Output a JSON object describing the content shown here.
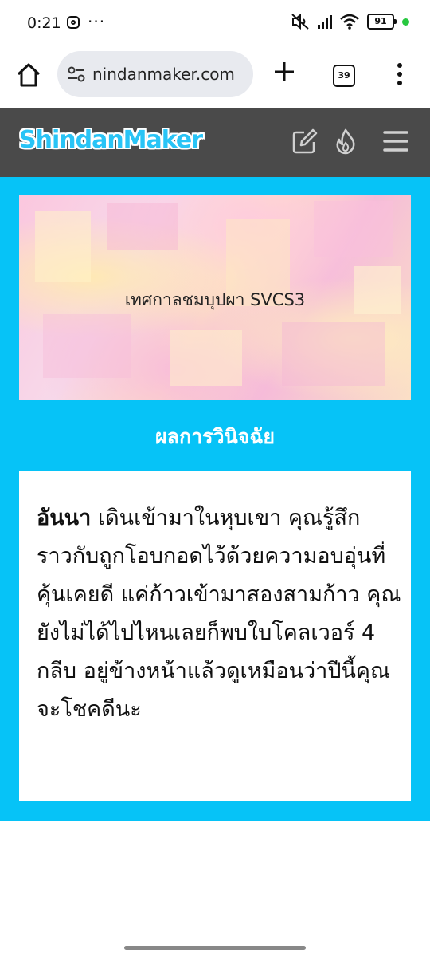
{
  "status_bar": {
    "time": "0:21",
    "dots": "···",
    "battery": "91",
    "dot_color": "#28c840"
  },
  "browser": {
    "url": "nindanmaker.com",
    "tab_count": "39"
  },
  "site": {
    "logo": "ShindanMaker",
    "header_bg": "#4a4a4a",
    "accent": "#06c3f7"
  },
  "banner": {
    "title": "เทศกาลชมบุปผา SVCS3"
  },
  "result": {
    "heading": "ผลการวินิจฉัย",
    "name": "อันนา",
    "text": " เดินเข้ามาในหุบเขา คุณรู้สึกราวกับถูกโอบกอดไว้ด้วยความอบอุ่นที่คุ้นเคยดี แค่ก้าวเข้ามาสองสามก้าว คุณยังไม่ได้ไปไหนเลยก็พบใบโคลเวอร์ 4 กลีบ อยู่ข้างหน้าแล้วดูเหมือนว่าปีนี้คุณจะโชคดีนะ"
  }
}
